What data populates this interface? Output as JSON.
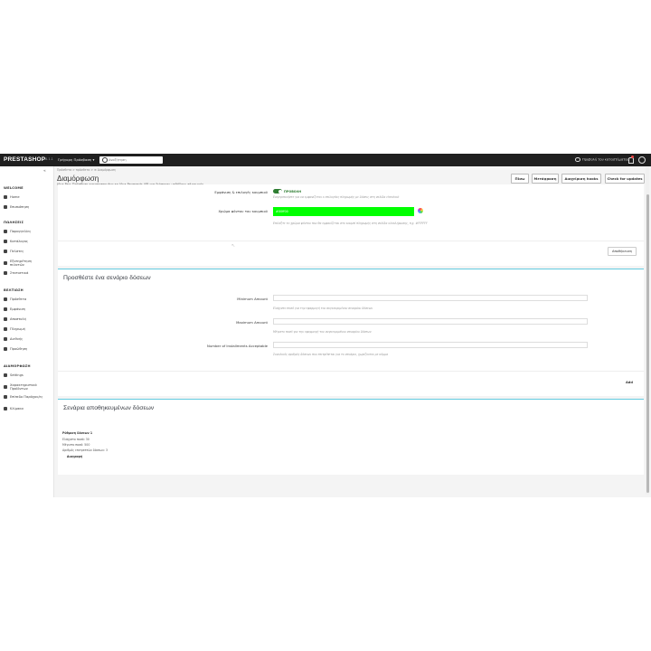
{
  "topbar": {
    "logo": "PRESTASHOP",
    "version": "8.1.1",
    "quick_access": "Γρήγορη Πρόσβαση ▾",
    "search_placeholder": "Αναζήτηση",
    "shop_link": "Προβολή του καταστήματος"
  },
  "sidebar": {
    "collapse_icon": "«",
    "sections": [
      {
        "title": "WELCOME",
        "items": [
          "Home",
          "Επισκόπηση"
        ]
      },
      {
        "title": "ΠΩΛΗΣΕΙΣ",
        "items": [
          "Παραγγελίες",
          "Κατάλογος",
          "Πελάτες",
          "Εξυπηρέτηση πελατών",
          "Στατιστικά"
        ]
      },
      {
        "title": "ΒΕΛΤΙΩΣΗ",
        "items": [
          "Πρόσθετα",
          "Εμφάνιση",
          "Αποστολή",
          "Πληρωμή",
          "Διεθνής",
          "Προώθηση"
        ]
      },
      {
        "title": "ΔΙΑΜΟΡΦΩΣΗ",
        "items": [
          "Settings",
          "Χαρακτηριστικά Προϊόντων",
          "Επίπεδο Παρόχου/ες",
          "Κλίμακα"
        ]
      }
    ]
  },
  "header": {
    "breadcrumb": "Πρόσθετα  >  πρόσθετα  >  ⊕ Διαμόρφωση",
    "title": "Διαμόρφωση",
    "subtitle": "Viva Pay: Πρόσθετο εγκατεστημένο το Viva Payments API για διάφορες μεθόδους πληρωμής",
    "buttons": [
      "Πίσω",
      "Μετάφραση",
      "Διαχείριση hooks",
      "Check for updates"
    ]
  },
  "settings": {
    "row1_label": "Εμφάνιση & επιλογές κουμπιού",
    "row1_toggle_text": "ΠΡΟΒΟΛΗ",
    "row1_help": "Ενεργοποιήστε για να εμφανίζεται ο επιλογέας πληρωμής με δόσεις στη σελίδα checkout",
    "row2_label": "Χρώμα φόντου του κουμπιού",
    "row2_value": "#00ff00",
    "row2_help": "Επιλέξτε το χρώμα φόντου που θα εμφανίζεται στο κουμπί πληρωμής στη σελίδα ολοκλήρωσης, π.χ. #FFFFFF",
    "save_button": "Αποθήκευση",
    "accent_color": "#00ff00"
  },
  "add_scenario": {
    "title": "Προσθέστε ένα σενάριο δόσεων",
    "fields": [
      {
        "label": "Minimum Amount",
        "help": "Ελάχιστο ποσό για την εφαρμογή του συγκεκριμένου σεναρίου δόσεων"
      },
      {
        "label": "Maximum Amount",
        "help": "Μέγιστο ποσό για την εφαρμογή του συγκεκριμένου σεναρίου δόσεων"
      },
      {
        "label": "Number of Installments Acceptable",
        "help": "Συνολικός αριθμός δόσεων που επιτρέπεται για το σενάριο, χωρίζονται με κόμμα"
      }
    ],
    "add_button": "Add"
  },
  "saved": {
    "title": "Σενάρια αποθηκευμένων δόσεων",
    "entry_title": "Ρύθμιση δόσεων 1",
    "entry_lines": [
      "Ελάχιστο ποσό: 30",
      "Μέγιστο ποσό: 500",
      "Αριθμός επιτρεπτών δόσεων: 3"
    ],
    "delete_link": "Διαγραφή"
  }
}
